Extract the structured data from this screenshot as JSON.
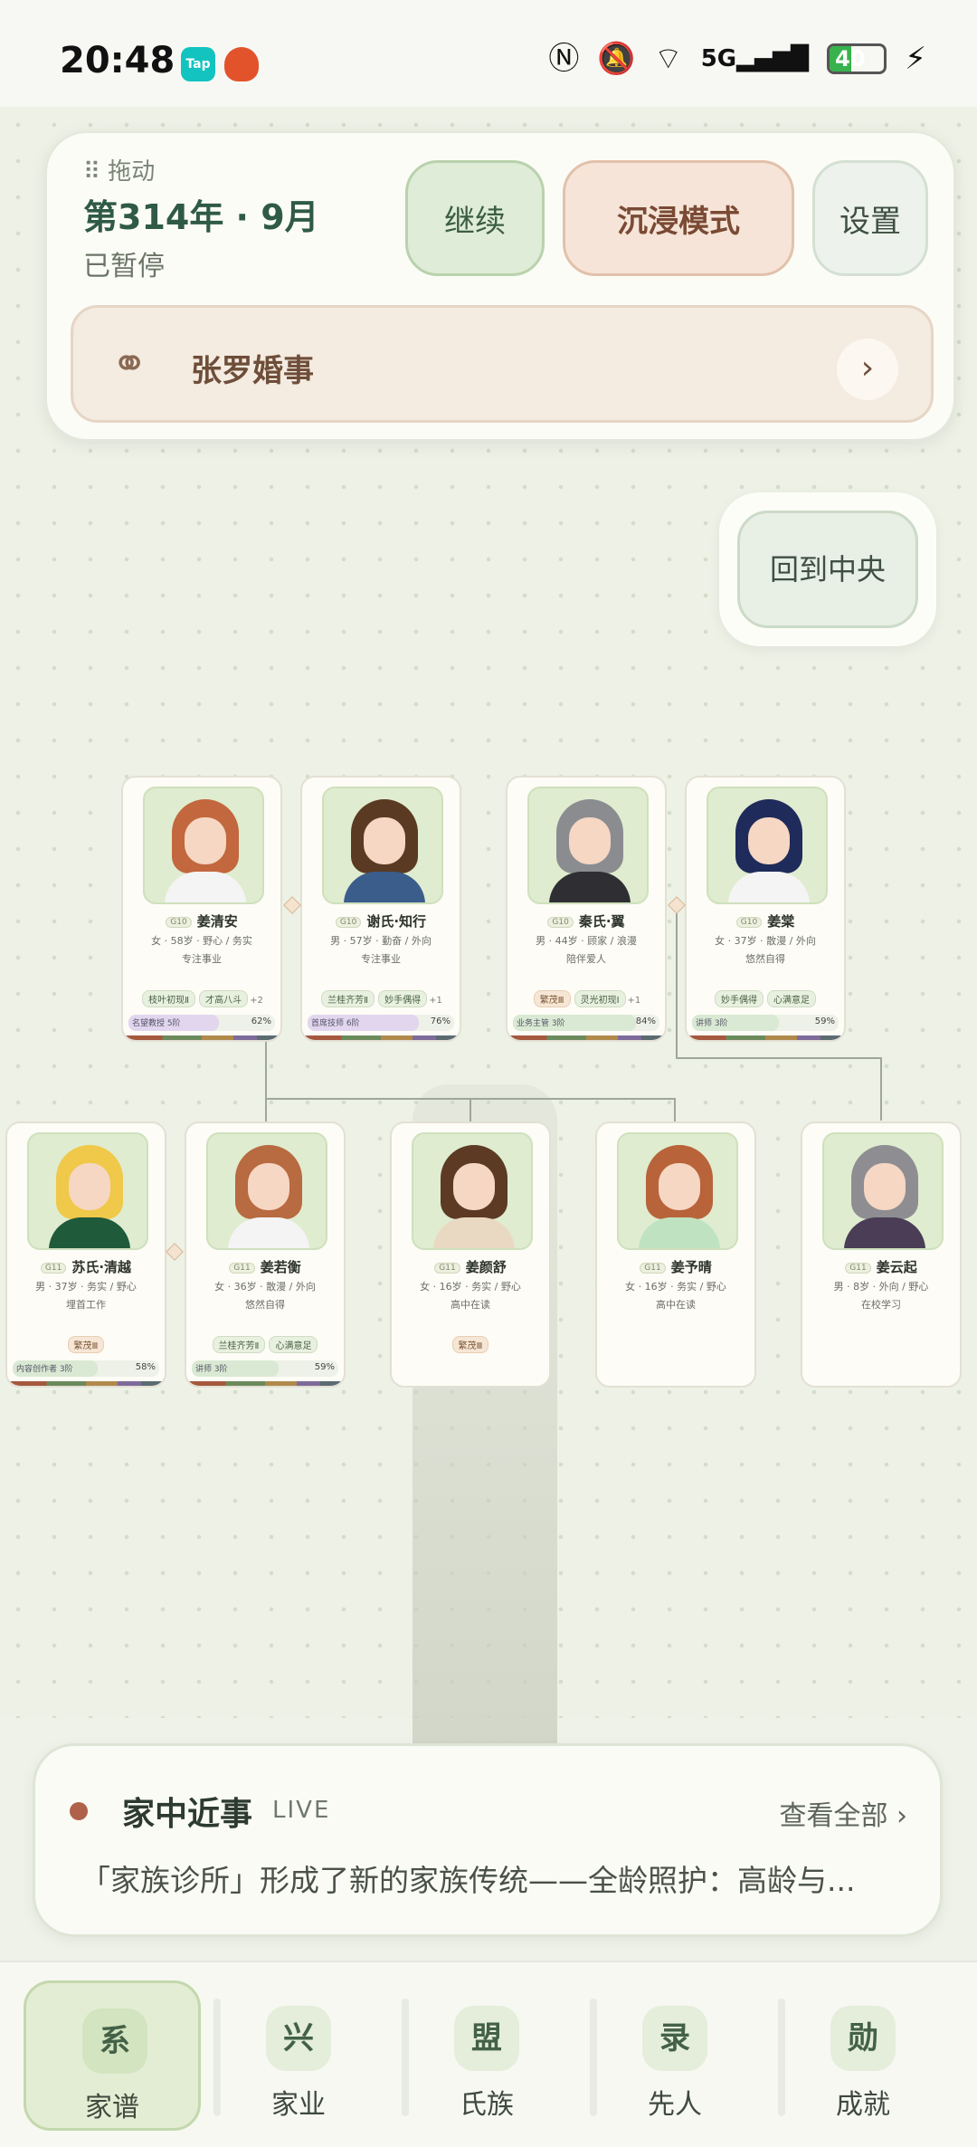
{
  "status_bar": {
    "time": "20:48",
    "apps": [
      {
        "name": "Tap",
        "color": "#12c3c0"
      },
      {
        "name": "",
        "color": "#e2532b"
      }
    ],
    "icons": [
      "nfc-icon",
      "mute-icon",
      "wifi-icon",
      "signal-5g-icon"
    ],
    "network": "5G",
    "battery": "40",
    "battery_level": 0.4
  },
  "top_panel": {
    "drag_label": "⠿ 拖动",
    "era": "第314年 · 9月",
    "state": "已暂停",
    "buttons": {
      "continue": "继续",
      "immersive": "沉浸模式",
      "settings": "设置"
    },
    "marriage_label": "张罗婚事"
  },
  "recenter_label": "回到中央",
  "family_tree": {
    "generation_10": [
      {
        "gen": "G10",
        "name": "姜清安",
        "info": "女 · 58岁 · 野心 / 务实",
        "status": "专注事业",
        "tags": [
          "枝叶初现Ⅱ",
          "才高八斗"
        ],
        "more": "+2",
        "job": "名望教授 5阶",
        "progress": 62,
        "progress_text": "62%",
        "bar_color": "#e2d6ef",
        "hair": "#c2673e",
        "shirt": "#f4f4f4"
      },
      {
        "gen": "G10",
        "name": "谢氏·知行",
        "info": "男 · 57岁 · 勤奋 / 外向",
        "status": "专注事业",
        "tags": [
          "兰桂齐芳Ⅱ",
          "妙手偶得"
        ],
        "more": "+1",
        "job": "首席技师 6阶",
        "progress": 76,
        "progress_text": "76%",
        "bar_color": "#e2d6ef",
        "hair": "#5a3a22",
        "shirt": "#3a5d8c"
      },
      {
        "gen": "G10",
        "name": "秦氏·翼",
        "info": "男 · 44岁 · 顾家 / 浪漫",
        "status": "陪伴爱人",
        "tags": [
          "繁茂Ⅲ",
          "灵光初现Ⅰ"
        ],
        "more": "+1",
        "job": "业务主管 3阶",
        "progress": 84,
        "progress_text": "84%",
        "bar_color": "#d9e9d3",
        "hair": "#8b8c90",
        "shirt": "#2f2f33"
      },
      {
        "gen": "G10",
        "name": "姜棠",
        "info": "女 · 37岁 · 散漫 / 外向",
        "status": "悠然自得",
        "tags": [
          "妙手偶得",
          "心满意足"
        ],
        "more": "",
        "job": "讲师 3阶",
        "progress": 59,
        "progress_text": "59%",
        "bar_color": "#d9e9d3",
        "hair": "#1f2b5a",
        "shirt": "#f4f4f4"
      }
    ],
    "generation_11": [
      {
        "gen": "G11",
        "name": "苏氏·清越",
        "info": "男 · 37岁 · 务实 / 野心",
        "status": "埋首工作",
        "tags": [
          "繁茂Ⅲ"
        ],
        "more": "",
        "job": "内容创作者 3阶",
        "progress": 58,
        "progress_text": "58%",
        "bar_color": "#d9e9d3",
        "hair": "#f0c84a",
        "shirt": "#1f5a3a"
      },
      {
        "gen": "G11",
        "name": "姜若衡",
        "info": "女 · 36岁 · 散漫 / 外向",
        "status": "悠然自得",
        "tags": [
          "兰桂齐芳Ⅱ",
          "心满意足"
        ],
        "more": "",
        "job": "讲师 3阶",
        "progress": 59,
        "progress_text": "59%",
        "bar_color": "#d9e9d3",
        "hair": "#b86a40",
        "shirt": "#f4f4f4"
      },
      {
        "gen": "G11",
        "name": "姜颜舒",
        "info": "女 · 16岁 · 务实 / 野心",
        "status": "高中在读",
        "tags": [
          "繁茂Ⅲ"
        ],
        "more": "",
        "job": "",
        "progress": null,
        "progress_text": "",
        "bar_color": "",
        "hair": "#5c3a24",
        "shirt": "#ead9c2"
      },
      {
        "gen": "G11",
        "name": "姜予晴",
        "info": "女 · 16岁 · 务实 / 野心",
        "status": "高中在读",
        "tags": [],
        "more": "",
        "job": "",
        "progress": null,
        "progress_text": "",
        "bar_color": "",
        "hair": "#b8633a",
        "shirt": "#bfe3c0"
      },
      {
        "gen": "G11",
        "name": "姜云起",
        "info": "男 · 8岁 · 外向 / 野心",
        "status": "在校学习",
        "tags": [],
        "more": "",
        "job": "",
        "progress": null,
        "progress_text": "",
        "bar_color": "",
        "hair": "#8e8e92",
        "shirt": "#4a3d55"
      }
    ]
  },
  "news": {
    "title": "家中近事",
    "live": "LIVE",
    "view_all": "查看全部 ›",
    "text": "「家族诊所」形成了新的家族传统——全龄照护：高龄与..."
  },
  "bottom_nav": [
    {
      "glyph": "系",
      "label": "家谱",
      "active": true
    },
    {
      "glyph": "兴",
      "label": "家业",
      "active": false
    },
    {
      "glyph": "盟",
      "label": "氏族",
      "active": false
    },
    {
      "glyph": "录",
      "label": "先人",
      "active": false
    },
    {
      "glyph": "勋",
      "label": "成就",
      "active": false
    }
  ]
}
